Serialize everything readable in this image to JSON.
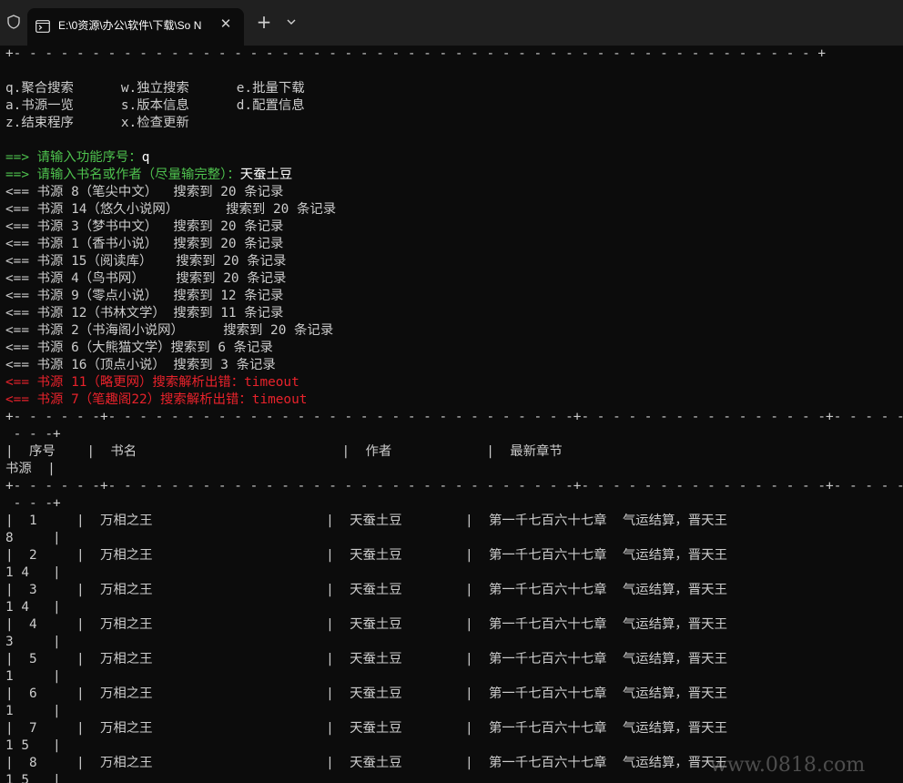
{
  "window": {
    "tab_title": "E:\\0资源\\办公\\软件\\下载\\So N",
    "close_glyph": "✕",
    "new_tab_glyph": "+"
  },
  "console": {
    "menu_border": "+- - - - - - - - - - - - - - - - - - - - - - - - - - - - - - - - - - - - - - - - - - - - - - - - - - - +",
    "menu_rows": [
      "q.聚合搜索      w.独立搜索      e.批量下载",
      "a.书源一览      s.版本信息      d.配置信息",
      "z.结束程序      x.检查更新"
    ],
    "prompts": [
      {
        "label": "==> 请输入功能序号：",
        "value": "q"
      },
      {
        "label": "==> 请输入书名或作者（尽量输完整）：",
        "value": "天蚕土豆"
      }
    ],
    "search_results": [
      "<== 书源 8（笔尖中文）  搜索到 20 条记录",
      "<== 书源 14（悠久小说网）      搜索到 20 条记录",
      "<== 书源 3（梦书中文）  搜索到 20 条记录",
      "<== 书源 1（香书小说）  搜索到 20 条记录",
      "<== 书源 15（阅读库）   搜索到 20 条记录",
      "<== 书源 4（鸟书网）    搜索到 20 条记录",
      "<== 书源 9（零点小说）  搜索到 12 条记录",
      "<== 书源 12（书林文学） 搜索到 11 条记录",
      "<== 书源 2（书海阁小说网）     搜索到 20 条记录",
      "<== 书源 6（大熊猫文学）搜索到 6 条记录",
      "<== 书源 16（顶点小说） 搜索到 3 条记录"
    ],
    "errors": [
      "<== 书源 11（略更网）搜索解析出错：timeout",
      "<== 书源 7（笔趣阁22）搜索解析出错：timeout"
    ],
    "table_border": "+- - - - - -+- - - - - - - - - - - - - - - - - - - - - - - - - - - - - -+- - - - - - - - - - - - - - - -+- - - - - - - - - - - - - - - - - - - - - - - - - - - - - - -",
    "table_border_wrap": " - - -+",
    "table_header": "|  序号    |  书名                          |  作者            |  最新章节",
    "table_header_wrap": "书源  |",
    "rows": [
      {
        "line": "|  1     |  万相之王                      |  天蚕土豆        |  第一千七百六十七章  气运结算，晋天王",
        "source": "8     |"
      },
      {
        "line": "|  2     |  万相之王                      |  天蚕土豆        |  第一千七百六十七章  气运结算，晋天王",
        "source": "1 4   |"
      },
      {
        "line": "|  3     |  万相之王                      |  天蚕土豆        |  第一千七百六十七章  气运结算，晋天王",
        "source": "1 4   |"
      },
      {
        "line": "|  4     |  万相之王                      |  天蚕土豆        |  第一千七百六十七章  气运结算，晋天王",
        "source": "3     |"
      },
      {
        "line": "|  5     |  万相之王                      |  天蚕土豆        |  第一千七百六十七章  气运结算，晋天王",
        "source": "1     |"
      },
      {
        "line": "|  6     |  万相之王                      |  天蚕土豆        |  第一千七百六十七章  气运结算，晋天王",
        "source": "1     |"
      },
      {
        "line": "|  7     |  万相之王                      |  天蚕土豆        |  第一千七百六十七章  气运结算，晋天王",
        "source": "1 5   |"
      },
      {
        "line": "|  8     |  万相之王                      |  天蚕土豆        |  第一千七百六十七章  气运结算，晋天王",
        "source": "1 5   |"
      }
    ]
  },
  "watermark": "www.0818.com",
  "colors": {
    "background": "#0c0c0c",
    "titlebar": "#202020",
    "text": "#cccccc",
    "prompt": "#4ec24e",
    "error": "#e8222b"
  }
}
